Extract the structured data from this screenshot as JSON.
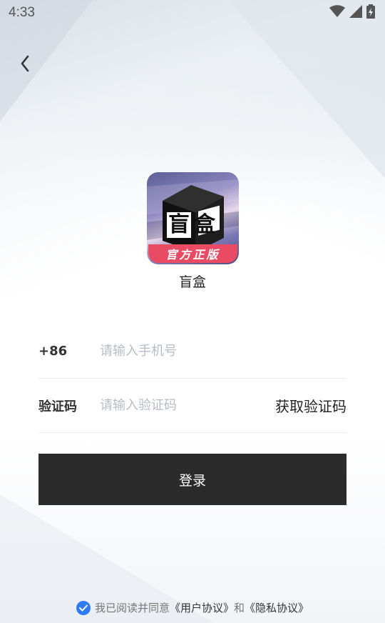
{
  "status_bar": {
    "time": "4:33",
    "icons": [
      "wifi-icon",
      "cellular-signal-icon",
      "battery-charging-icon"
    ]
  },
  "nav": {
    "back_icon": "chevron-left-icon"
  },
  "app": {
    "name": "盲盒",
    "logo_glyphs": "盲盒",
    "logo_ribbon": "官方正版"
  },
  "form": {
    "country_code": "+86",
    "phone_placeholder": "请输入手机号",
    "code_label": "验证码",
    "code_placeholder": "请输入验证码",
    "get_code_label": "获取验证码",
    "login_label": "登录"
  },
  "agreement": {
    "checked": true,
    "prefix": "我已阅读并同意",
    "user_agreement": "《用户协议》",
    "conjunction": "和",
    "privacy_agreement": "《隐私协议》"
  },
  "colors": {
    "accent_blue": "#2d7cf6",
    "button_dark": "#2b2b2b",
    "ribbon_red": "#e94b63"
  }
}
